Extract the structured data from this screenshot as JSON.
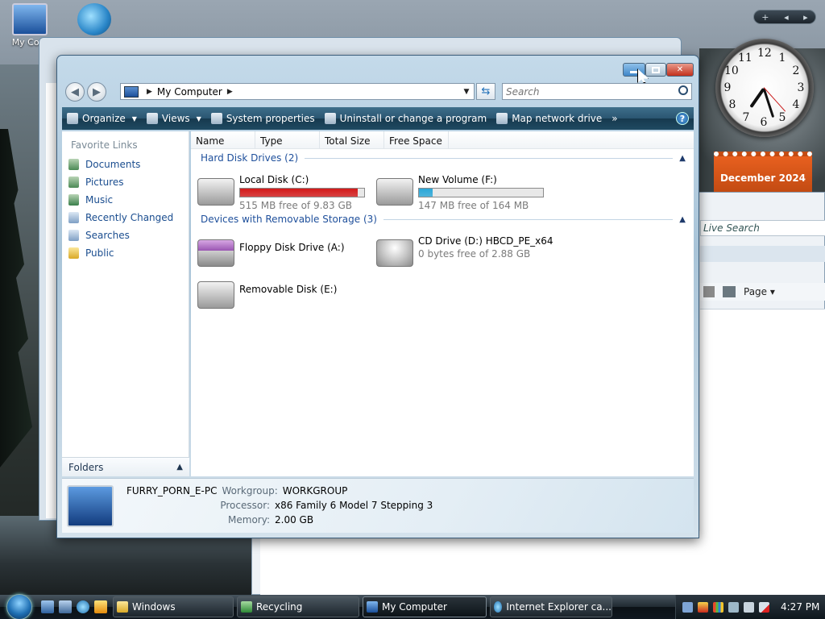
{
  "desktop": {
    "icons": [
      {
        "label": "My Com",
        "icon": "computer-icon"
      },
      {
        "label": "",
        "icon": "ie-shortcut-icon"
      }
    ],
    "calendar": {
      "month": "December 2024"
    },
    "clock": {
      "numbers": [
        "12",
        "1",
        "2",
        "3",
        "4",
        "5",
        "6",
        "7",
        "8",
        "9",
        "10",
        "11"
      ]
    }
  },
  "window": {
    "address": {
      "root": "My Computer"
    },
    "search": {
      "placeholder": "Search"
    },
    "commands": [
      {
        "label": "Organize",
        "icon": "organize-icon",
        "dropdown": true
      },
      {
        "label": "Views",
        "icon": "views-icon",
        "dropdown": true
      },
      {
        "label": "System properties",
        "icon": "system-properties-icon",
        "dropdown": false
      },
      {
        "label": "Uninstall or change a program",
        "icon": "uninstall-icon",
        "dropdown": false
      },
      {
        "label": "Map network drive",
        "icon": "map-drive-icon",
        "dropdown": false
      }
    ],
    "overflow": "»",
    "help": "?",
    "nav": {
      "header": "Favorite Links",
      "items": [
        {
          "label": "Documents",
          "icon": "documents-icon"
        },
        {
          "label": "Pictures",
          "icon": "pictures-icon"
        },
        {
          "label": "Music",
          "icon": "music-icon"
        },
        {
          "label": "Recently Changed",
          "icon": "recently-changed-icon"
        },
        {
          "label": "Searches",
          "icon": "searches-icon"
        },
        {
          "label": "Public",
          "icon": "public-folder-icon"
        }
      ],
      "folders": "Folders"
    },
    "columns": [
      "Name",
      "Type",
      "Total Size",
      "Free Space"
    ],
    "groups": {
      "hdd": "Hard Disk Drives (2)",
      "removable": "Devices with Removable Storage (3)"
    },
    "drives": {
      "c": {
        "name": "Local Disk (C:)",
        "free": "515 MB free of 9.83 GB",
        "used_fraction": 0.95,
        "color": "#d31a1a"
      },
      "f": {
        "name": "New Volume (F:)",
        "free": "147 MB free of 164 MB",
        "used_fraction": 0.11,
        "color": "#2aa7d8"
      },
      "a": {
        "name": "Floppy Disk Drive (A:)"
      },
      "d": {
        "name": "CD Drive (D:) HBCD_PE_x64",
        "free": "0 bytes free of 2.88 GB"
      },
      "e": {
        "name": "Removable Disk (E:)"
      }
    },
    "details": {
      "computer_name": "FURRY_PORN_E-PC",
      "workgroup_label": "Workgroup:",
      "workgroup": "WORKGROUP",
      "processor_label": "Processor:",
      "processor": "x86 Family 6 Model 7 Stepping 3",
      "memory_label": "Memory:",
      "memory": "2.00 GB"
    }
  },
  "ie_window": {
    "search": "Live Search",
    "page_label": "Page"
  },
  "taskbar": {
    "buttons": [
      {
        "label": "Windows",
        "icon": "folder-icon"
      },
      {
        "label": "Recycling",
        "icon": "recycle-icon"
      },
      {
        "label": "My Computer",
        "icon": "computer-icon",
        "active": true
      },
      {
        "label": "Internet Explorer ca...",
        "icon": "ie-icon"
      }
    ],
    "time": "4:27 PM"
  },
  "sidebar_controls": {
    "add": "+"
  }
}
